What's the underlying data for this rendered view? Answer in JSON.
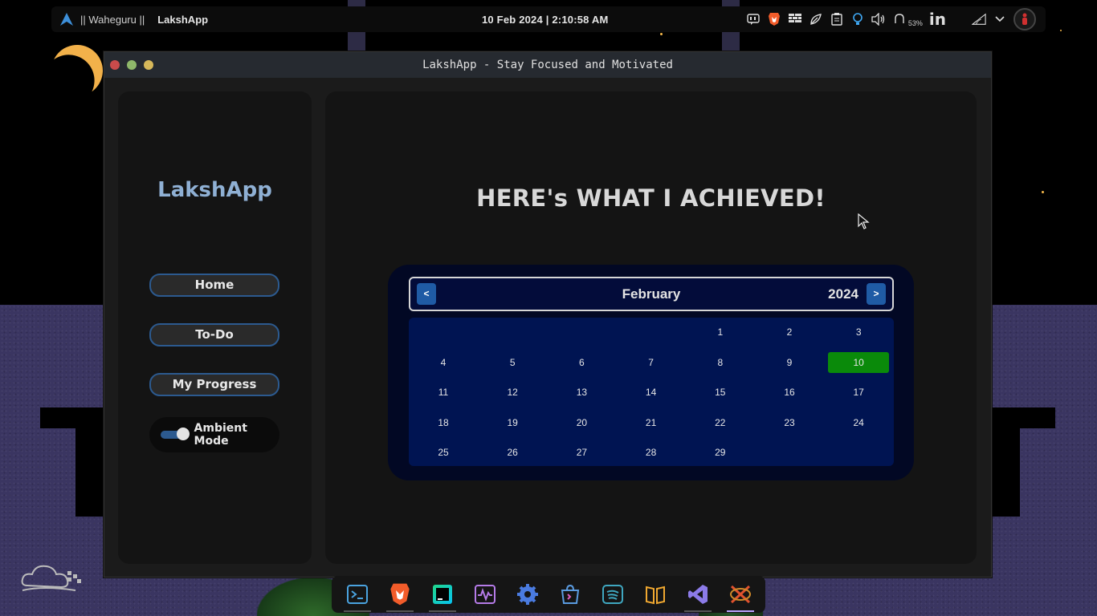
{
  "topbar": {
    "workspace": "|| Waheguru ||",
    "app_name": "LakshApp",
    "clock": "10 Feb 2024 | 2:10:58 AM",
    "battery_percent": "53%",
    "linkedin_label": "in",
    "tray_icons": [
      "caption-icon",
      "brave-icon",
      "firewall-icon",
      "leaf-icon",
      "clipboard-icon",
      "bulb-icon",
      "volume-icon",
      "battery-icon",
      "linkedin-icon",
      "wifi-icon",
      "chevron-down-icon",
      "avatar"
    ]
  },
  "window": {
    "title": "LakshApp - Stay Focused and Motivated"
  },
  "sidebar": {
    "brand": "LakshApp",
    "nav": [
      {
        "label": "Home"
      },
      {
        "label": "To-Do"
      },
      {
        "label": "My Progress"
      }
    ],
    "ambient_label": "Ambient Mode",
    "ambient_on": true
  },
  "main": {
    "heading": "HERE's WHAT I ACHIEVED!"
  },
  "calendar": {
    "prev": "<",
    "next": ">",
    "month": "February",
    "year": "2024",
    "first_weekday_index": 4,
    "days_in_month": 29,
    "today": 10,
    "today_color": "#0a8a0a"
  },
  "dock": {
    "items": [
      "terminal-icon",
      "brave-browser-icon",
      "pycharm-icon",
      "system-monitor-icon",
      "settings-icon",
      "appimage-store-icon",
      "spotify-icon",
      "books-icon",
      "vscode-icon",
      "xfce-app-icon"
    ],
    "active": "xfce-app-icon"
  },
  "colors": {
    "accent": "#2c5a8f",
    "brand": "#8fb0d4",
    "calendar_bg": "#001452"
  }
}
